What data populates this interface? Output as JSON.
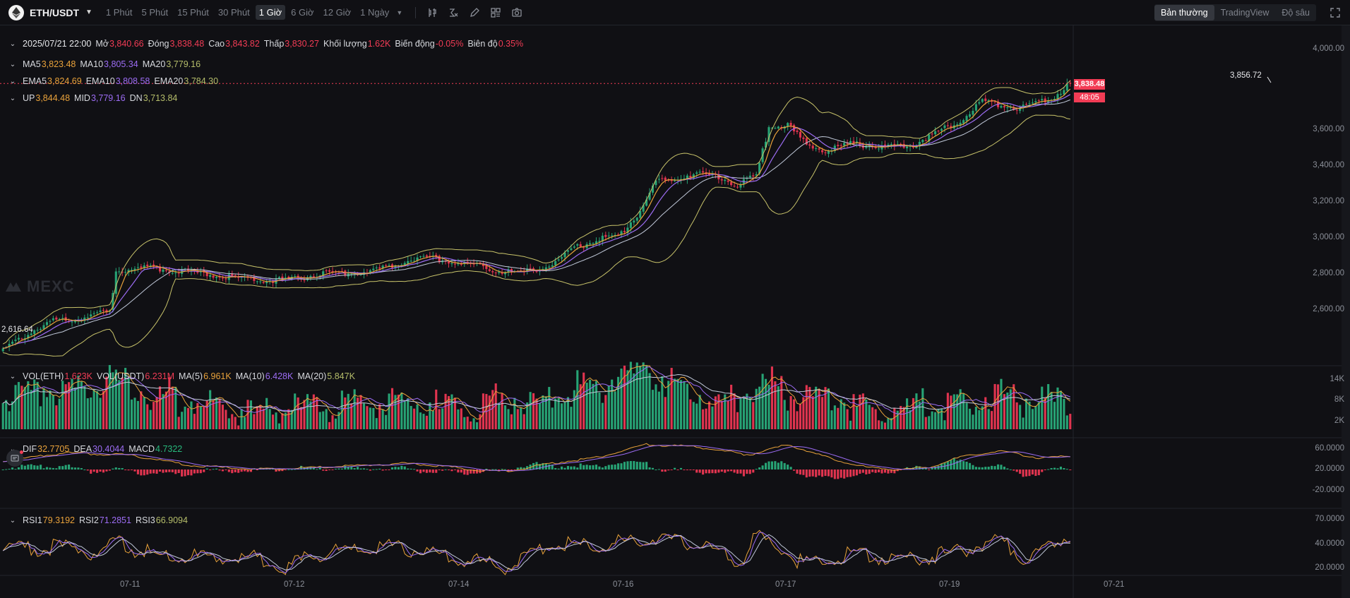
{
  "toolbar": {
    "symbol": "ETH/USDT",
    "intervals": [
      "1 Phút",
      "5 Phút",
      "15 Phút",
      "30 Phút",
      "1 Giờ",
      "6 Giờ",
      "12 Giờ",
      "1 Ngày"
    ],
    "active_interval": "1 Giờ",
    "views": [
      "Bản thường",
      "TradingView",
      "Độ sâu"
    ],
    "active_view": "Bản thường"
  },
  "ohlc": {
    "date": "2025/07/21 22:00",
    "open_label": "Mở",
    "open": "3,840.66",
    "close_label": "Đóng",
    "close": "3,838.48",
    "high_label": "Cao",
    "high": "3,843.82",
    "low_label": "Thấp",
    "low": "3,830.27",
    "volume_label": "Khối lượng",
    "volume": "1.62K",
    "change_label": "Biến động",
    "change": "-0.05%",
    "amplitude_label": "Biên độ",
    "amplitude": "0.35%"
  },
  "ma": {
    "ma5_label": "MA5",
    "ma5": "3,823.48",
    "ma10_label": "MA10",
    "ma10": "3,805.34",
    "ma20_label": "MA20",
    "ma20": "3,779.16"
  },
  "ema": {
    "ema5_label": "EMA5",
    "ema5": "3,824.69",
    "ema10_label": "EMA10",
    "ema10": "3,808.58",
    "ema20_label": "EMA20",
    "ema20": "3,784.30"
  },
  "boll": {
    "up_label": "UP",
    "up": "3,844.48",
    "mid_label": "MID",
    "mid": "3,779.16",
    "dn_label": "DN",
    "dn": "3,713.84"
  },
  "vol": {
    "eth_label": "VOL(ETH)",
    "eth": "1.623K",
    "usdt_label": "VOL(USDT)",
    "usdt": "6.231M",
    "ma5_label": "MA(5)",
    "ma5": "6.961K",
    "ma10_label": "MA(10)",
    "ma10": "6.428K",
    "ma20_label": "MA(20)",
    "ma20": "5.847K"
  },
  "macd": {
    "dif_label": "DIF",
    "dif": "32.7705",
    "dea_label": "DEA",
    "dea": "30.4044",
    "macd_label": "MACD",
    "macd": "4.7322"
  },
  "rsi": {
    "rsi1_label": "RSI1",
    "rsi1": "79.3192",
    "rsi2_label": "RSI2",
    "rsi2": "71.2851",
    "rsi3_label": "RSI3",
    "rsi3": "66.9094"
  },
  "price_axis": [
    "4,000.00",
    "3,600.00",
    "3,400.00",
    "3,200.00",
    "3,000.00",
    "2,800.00",
    "2,600.00"
  ],
  "vol_axis": [
    "14K",
    "8K",
    "2K"
  ],
  "macd_axis": [
    "60.0000",
    "20.0000",
    "-20.0000"
  ],
  "rsi_axis": [
    "70.0000",
    "40.0000",
    "20.0000"
  ],
  "last_price": "3,838.48",
  "countdown": "48:05",
  "high_marker": "3,856.72",
  "low_marker": "2,616.64",
  "watermark": "MEXC",
  "dates": [
    "07-11",
    "07-12",
    "07-14",
    "07-16",
    "07-17",
    "07-19",
    "07-21"
  ],
  "colors": {
    "up": "#27a375",
    "down": "#e0344f",
    "ma5": "#e9a23b",
    "ma10": "#9c6cf3",
    "ma20": "#c0c8d8",
    "boll": "#c8c36a"
  },
  "chart_data": {
    "type": "candlestick",
    "interval": "1 Giờ",
    "ylim": [
      2560,
      4090
    ],
    "price_path": [
      [
        0,
        2625
      ],
      [
        8,
        2700
      ],
      [
        16,
        2760
      ],
      [
        24,
        2770
      ],
      [
        30,
        2790
      ],
      [
        34,
        2795
      ],
      [
        36,
        2990
      ],
      [
        40,
        2995
      ],
      [
        46,
        3000
      ],
      [
        54,
        2990
      ],
      [
        62,
        2975
      ],
      [
        72,
        2960
      ],
      [
        82,
        2940
      ],
      [
        92,
        2945
      ],
      [
        100,
        2970
      ],
      [
        110,
        2975
      ],
      [
        118,
        2985
      ],
      [
        126,
        3020
      ],
      [
        134,
        3050
      ],
      [
        142,
        3030
      ],
      [
        150,
        3010
      ],
      [
        158,
        2985
      ],
      [
        164,
        2975
      ],
      [
        170,
        2990
      ],
      [
        176,
        3020
      ],
      [
        182,
        3090
      ],
      [
        190,
        3130
      ],
      [
        196,
        3140
      ],
      [
        202,
        3240
      ],
      [
        208,
        3390
      ],
      [
        214,
        3400
      ],
      [
        220,
        3430
      ],
      [
        228,
        3410
      ],
      [
        234,
        3380
      ],
      [
        240,
        3420
      ],
      [
        244,
        3640
      ],
      [
        250,
        3650
      ],
      [
        256,
        3560
      ],
      [
        262,
        3530
      ],
      [
        270,
        3565
      ],
      [
        280,
        3550
      ],
      [
        290,
        3560
      ],
      [
        298,
        3620
      ],
      [
        306,
        3680
      ],
      [
        312,
        3760
      ],
      [
        318,
        3740
      ],
      [
        324,
        3730
      ],
      [
        334,
        3770
      ],
      [
        340,
        3838
      ]
    ],
    "volume_path_k": [
      [
        0,
        6
      ],
      [
        10,
        9
      ],
      [
        20,
        7
      ],
      [
        34,
        12
      ],
      [
        40,
        9
      ],
      [
        60,
        5
      ],
      [
        80,
        3
      ],
      [
        100,
        4
      ],
      [
        120,
        6
      ],
      [
        130,
        5
      ],
      [
        150,
        4
      ],
      [
        160,
        6
      ],
      [
        170,
        5
      ],
      [
        180,
        8
      ],
      [
        190,
        9
      ],
      [
        200,
        12
      ],
      [
        206,
        14
      ],
      [
        214,
        10
      ],
      [
        220,
        8
      ],
      [
        230,
        5
      ],
      [
        240,
        10
      ],
      [
        250,
        8
      ],
      [
        260,
        6
      ],
      [
        280,
        4
      ],
      [
        300,
        4
      ],
      [
        318,
        7
      ],
      [
        330,
        6
      ],
      [
        340,
        6
      ]
    ],
    "macd_path": [
      [
        0,
        20
      ],
      [
        20,
        40
      ],
      [
        40,
        35
      ],
      [
        60,
        10
      ],
      [
        80,
        0
      ],
      [
        100,
        5
      ],
      [
        115,
        10
      ],
      [
        130,
        15
      ],
      [
        150,
        0
      ],
      [
        160,
        -5
      ],
      [
        175,
        15
      ],
      [
        190,
        30
      ],
      [
        205,
        60
      ],
      [
        220,
        55
      ],
      [
        238,
        35
      ],
      [
        250,
        60
      ],
      [
        262,
        30
      ],
      [
        275,
        5
      ],
      [
        285,
        0
      ],
      [
        295,
        5
      ],
      [
        305,
        30
      ],
      [
        318,
        45
      ],
      [
        330,
        28
      ],
      [
        340,
        32
      ]
    ],
    "rsi_path": [
      [
        0,
        60
      ],
      [
        20,
        65
      ],
      [
        30,
        55
      ],
      [
        36,
        70
      ],
      [
        50,
        50
      ],
      [
        80,
        48
      ],
      [
        90,
        35
      ],
      [
        100,
        55
      ],
      [
        125,
        65
      ],
      [
        140,
        50
      ],
      [
        150,
        45
      ],
      [
        160,
        35
      ],
      [
        175,
        70
      ],
      [
        190,
        65
      ],
      [
        205,
        75
      ],
      [
        220,
        70
      ],
      [
        235,
        45
      ],
      [
        240,
        80
      ],
      [
        255,
        40
      ],
      [
        270,
        55
      ],
      [
        290,
        45
      ],
      [
        305,
        60
      ],
      [
        318,
        75
      ],
      [
        325,
        50
      ],
      [
        340,
        79
      ]
    ],
    "series": [
      {
        "name": "MA5",
        "value": 3823.48
      },
      {
        "name": "MA10",
        "value": 3805.34
      },
      {
        "name": "MA20",
        "value": 3779.16
      },
      {
        "name": "UP",
        "value": 3844.48
      },
      {
        "name": "MID",
        "value": 3779.16
      },
      {
        "name": "DN",
        "value": 3713.84
      }
    ]
  }
}
